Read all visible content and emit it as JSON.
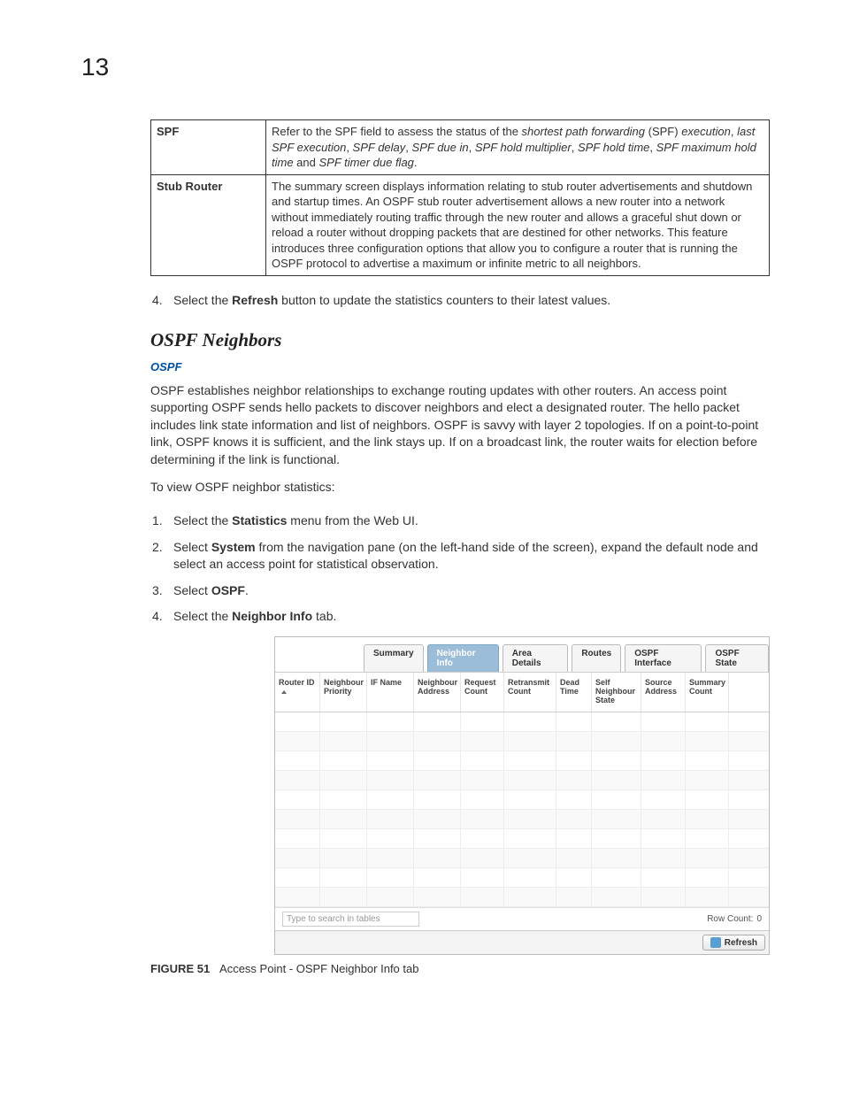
{
  "page_number": "13",
  "def_table": [
    {
      "label": "SPF",
      "text_parts": [
        {
          "t": "Refer to the SPF field to assess the status of the ",
          "i": false
        },
        {
          "t": "shortest path forwarding",
          "i": true
        },
        {
          "t": " (SPF) ",
          "i": false
        },
        {
          "t": "execution",
          "i": true
        },
        {
          "t": ", ",
          "i": false
        },
        {
          "t": "last SPF execution",
          "i": true
        },
        {
          "t": ", ",
          "i": false
        },
        {
          "t": "SPF delay",
          "i": true
        },
        {
          "t": ", ",
          "i": false
        },
        {
          "t": "SPF due in",
          "i": true
        },
        {
          "t": ", ",
          "i": false
        },
        {
          "t": "SPF hold multiplier",
          "i": true
        },
        {
          "t": ", ",
          "i": false
        },
        {
          "t": "SPF hold time",
          "i": true
        },
        {
          "t": ", ",
          "i": false
        },
        {
          "t": "SPF maximum hold time",
          "i": true
        },
        {
          "t": " and ",
          "i": false
        },
        {
          "t": "SPF timer due flag",
          "i": true
        },
        {
          "t": ".",
          "i": false
        }
      ]
    },
    {
      "label": "Stub Router",
      "text": "The summary screen displays information relating to stub router advertisements and shutdown and startup times. An OSPF stub router advertisement allows a new router into a network without immediately routing traffic through the new router and allows a graceful shut down or reload a router without dropping packets that are destined for other networks. This feature introduces three configuration options that allow you to configure a router that is running the OSPF protocol to advertise a maximum or infinite metric to all neighbors."
    }
  ],
  "step_after_table": {
    "num": "4.",
    "parts": [
      {
        "t": "Select the ",
        "b": false
      },
      {
        "t": "Refresh",
        "b": true
      },
      {
        "t": " button to update the statistics counters to their latest values.",
        "b": false
      }
    ]
  },
  "section_heading": "OSPF Neighbors",
  "sub_link": "OSPF",
  "body_para_1": "OSPF establishes neighbor relationships to exchange routing updates with other routers. An access point supporting OSPF sends hello packets to discover neighbors and elect a designated router. The hello packet includes link state information and list of neighbors. OSPF is savvy with layer 2 topologies. If on a point-to-point link, OSPF knows it is sufficient, and the link stays up. If on a broadcast link, the router waits for election before determining if the link is functional.",
  "body_para_2": "To view OSPF neighbor statistics:",
  "steps": [
    {
      "num": "1.",
      "parts": [
        {
          "t": "Select the ",
          "b": false
        },
        {
          "t": "Statistics",
          "b": true
        },
        {
          "t": " menu from the Web UI.",
          "b": false
        }
      ]
    },
    {
      "num": "2.",
      "parts": [
        {
          "t": "Select ",
          "b": false
        },
        {
          "t": "System",
          "b": true
        },
        {
          "t": " from the navigation pane (on the left-hand side of the screen), expand the default node and select an access point for statistical observation.",
          "b": false
        }
      ]
    },
    {
      "num": "3.",
      "parts": [
        {
          "t": "Select ",
          "b": false
        },
        {
          "t": "OSPF",
          "b": true
        },
        {
          "t": ".",
          "b": false
        }
      ]
    },
    {
      "num": "4.",
      "parts": [
        {
          "t": "Select the ",
          "b": false
        },
        {
          "t": "Neighbor Info",
          "b": true
        },
        {
          "t": " tab.",
          "b": false
        }
      ]
    }
  ],
  "screenshot": {
    "tabs": [
      "Summary",
      "Neighbor Info",
      "Area Details",
      "Routes",
      "OSPF Interface",
      "OSPF State"
    ],
    "active_tab_index": 1,
    "columns": [
      "Router ID",
      "Neighbour Priority",
      "IF Name",
      "Neighbour Address",
      "Request Count",
      "Retransmit Count",
      "Dead Time",
      "Self Neighbour State",
      "Source Address",
      "Summary Count"
    ],
    "empty_rows": 10,
    "search_placeholder": "Type to search in tables",
    "row_count_label": "Row Count:",
    "row_count_value": "0",
    "refresh_label": "Refresh"
  },
  "figure": {
    "label": "FIGURE 51",
    "caption": "Access Point - OSPF Neighbor Info tab"
  }
}
